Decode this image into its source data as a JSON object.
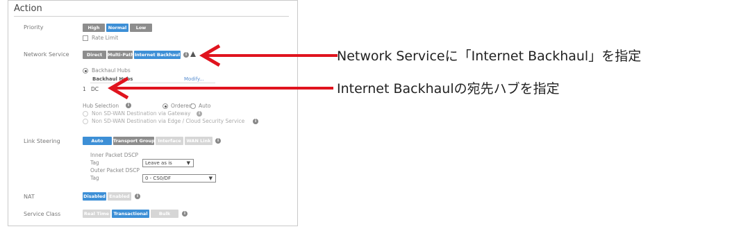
{
  "section": {
    "title": "Action"
  },
  "priority": {
    "label": "Priority",
    "buttons": [
      "High",
      "Normal",
      "Low"
    ],
    "selected": "Normal",
    "rate_limit": "Rate Limit"
  },
  "network_service": {
    "label": "Network Service",
    "buttons": [
      "Direct",
      "Multi-Path",
      "Internet Backhaul"
    ],
    "selected": "Internet Backhaul",
    "backhaul_hubs": "Backhaul Hubs",
    "hubs_header": "Backhaul Hubs",
    "modify_link": "Modify...",
    "hub_row_index": "1",
    "hub_row_name": "DC",
    "hub_selection": "Hub Selection",
    "ordered": "Ordered",
    "auto": "Auto",
    "option_gateway": "Non SD-WAN Destination via Gateway",
    "option_edge": "Non SD-WAN Destination via Edge / Cloud Security Service"
  },
  "link_steering": {
    "label": "Link Steering",
    "buttons": [
      "Auto",
      "Transport Group",
      "Interface",
      "WAN Link"
    ],
    "selected": "Auto",
    "inner_dscp": "Inner Packet DSCP",
    "inner_tag": "Tag",
    "inner_tag_value": "Leave as is",
    "outer_dscp": "Outer Packet DSCP",
    "outer_tag": "Tag",
    "outer_tag_value": "0 - CS0/DF"
  },
  "nat": {
    "label": "NAT",
    "buttons": [
      "Disabled",
      "Enabled"
    ],
    "selected": "Disabled"
  },
  "service_class": {
    "label": "Service Class",
    "buttons": [
      "Real Time",
      "Transactional",
      "Bulk"
    ],
    "selected": "Transactional"
  },
  "annotations": [
    "Network Serviceに「Internet Backhaul」を指定",
    "Internet Backhaulの宛先ハブを指定"
  ],
  "colors": {
    "selected": "#3d8fd6",
    "unselected": "#8d8d8d",
    "disabled": "#d6d6d6",
    "arrow": "#e0141e"
  },
  "icons": {
    "select_arrow": "▼",
    "info": "i"
  }
}
